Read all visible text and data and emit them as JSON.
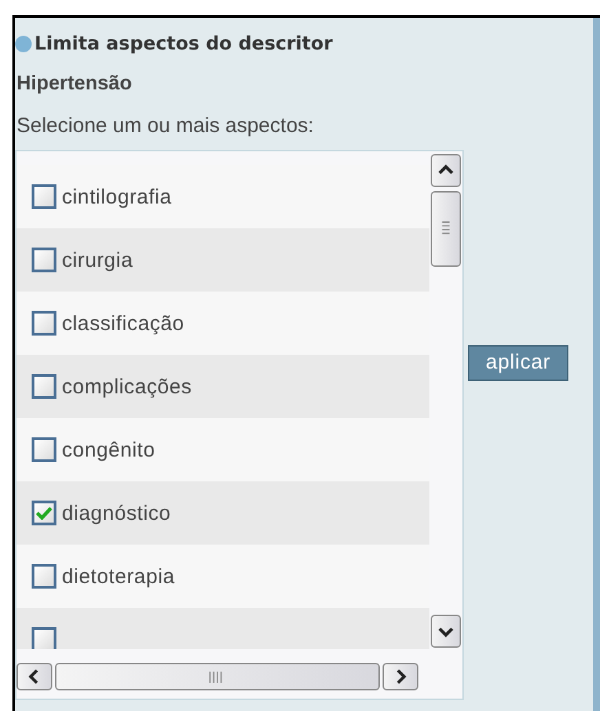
{
  "panel": {
    "title": "Limita aspectos do descritor",
    "descriptor": "Hipertensão",
    "instruction": "Selecione um ou mais aspectos:"
  },
  "aspects": [
    {
      "label": "cintilografia",
      "checked": false
    },
    {
      "label": "cirurgia",
      "checked": false
    },
    {
      "label": "classificação",
      "checked": false
    },
    {
      "label": "complicações",
      "checked": false
    },
    {
      "label": "congênito",
      "checked": false
    },
    {
      "label": "diagnóstico",
      "checked": true
    },
    {
      "label": "dietoterapia",
      "checked": false
    },
    {
      "checked": false
    }
  ],
  "apply_button": {
    "label": "aplicar"
  }
}
